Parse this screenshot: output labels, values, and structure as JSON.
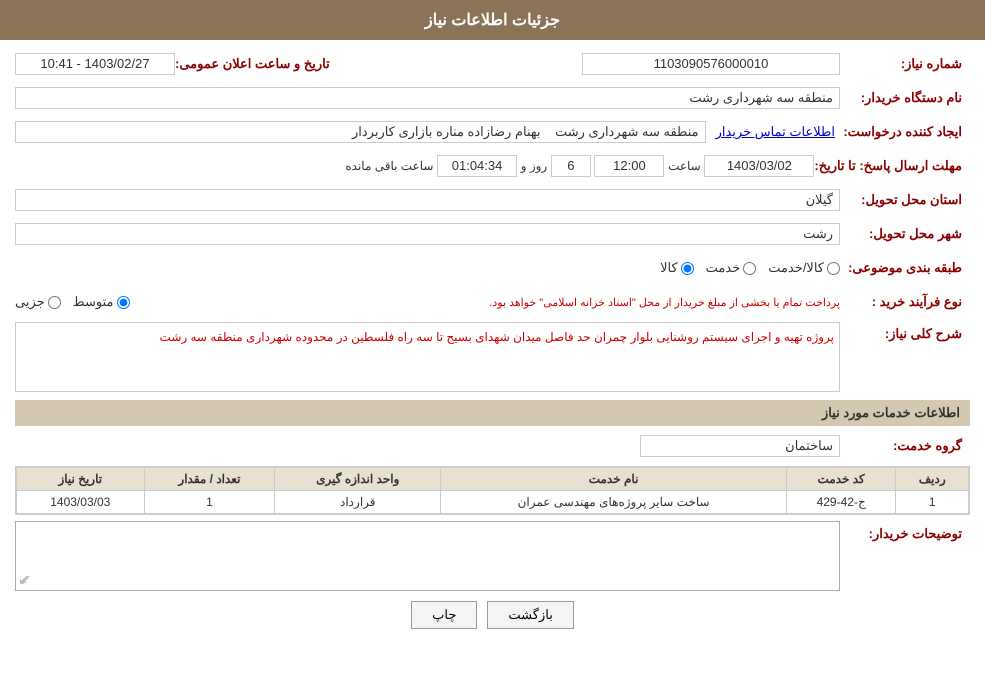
{
  "header": {
    "title": "جزئیات اطلاعات نیاز"
  },
  "fields": {
    "need_number_label": "شماره نیاز:",
    "need_number_value": "1103090576000010",
    "buyer_name_label": "نام دستگاه خریدار:",
    "buyer_name_value": "منطقه سه شهرداری رشت",
    "creator_label": "ایجاد کننده درخواست:",
    "creator_name": "بهنام رضازاده مناره بازاری کاربردار",
    "creator_org": "منطقه سه شهرداری رشت",
    "creator_link": "اطلاعات تماس خریدار",
    "response_date_label": "مهلت ارسال پاسخ: تا تاریخ:",
    "response_date": "1403/03/02",
    "response_time_label": "ساعت",
    "response_time": "12:00",
    "response_days_label": "روز و",
    "response_days": "6",
    "response_remaining_label": "ساعت باقی مانده",
    "response_remaining": "01:04:34",
    "announce_label": "تاریخ و ساعت اعلان عمومی:",
    "announce_value": "1403/02/27 - 10:41",
    "province_label": "استان محل تحویل:",
    "province_value": "گیلان",
    "city_label": "شهر محل تحویل:",
    "city_value": "رشت",
    "category_label": "طبقه بندی موضوعی:",
    "category_options": [
      "کالا",
      "خدمت",
      "کالا/خدمت"
    ],
    "category_selected": "کالا",
    "process_type_label": "نوع فرآیند خرید :",
    "process_options": [
      "جزیی",
      "متوسط"
    ],
    "process_selected": "متوسط",
    "process_note": "پرداخت تمام یا بخشی از مبلغ خریدار از محل \"اسناد خزانه اسلامی\" خواهد بود.",
    "description_label": "شرح کلی نیاز:",
    "description_text": "پروژه تهیه و اجرای سیستم روشنایی بلوار چمران حد فاصل میدان شهدای بسیج تا سه راه فلسطین در محدوده شهرداری منطقه سه رشت",
    "services_section_title": "اطلاعات خدمات مورد نیاز",
    "service_group_label": "گروه خدمت:",
    "service_group_value": "ساختمان",
    "table_headers": [
      "ردیف",
      "کد خدمت",
      "نام خدمت",
      "واحد اندازه گیری",
      "تعداد / مقدار",
      "تاریخ نیاز"
    ],
    "table_rows": [
      {
        "row": "1",
        "code": "ج-42-429",
        "name": "ساخت سایر پروژه‌های مهندسی عمران",
        "unit": "قرارداد",
        "quantity": "1",
        "date": "1403/03/03"
      }
    ],
    "buyer_notes_label": "توضیحات خریدار:",
    "print_button": "چاپ",
    "back_button": "بازگشت"
  }
}
